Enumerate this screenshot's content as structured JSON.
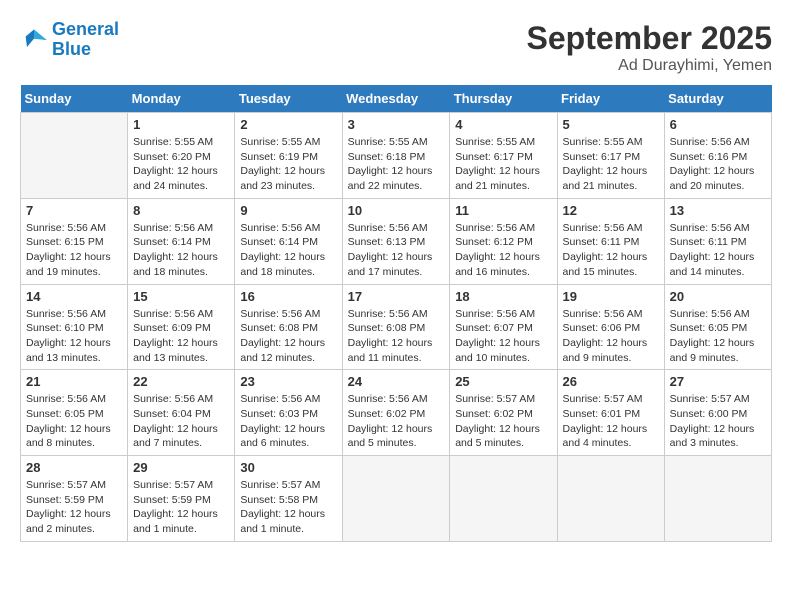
{
  "header": {
    "logo_line1": "General",
    "logo_line2": "Blue",
    "month": "September 2025",
    "location": "Ad Durayhimi, Yemen"
  },
  "weekdays": [
    "Sunday",
    "Monday",
    "Tuesday",
    "Wednesday",
    "Thursday",
    "Friday",
    "Saturday"
  ],
  "weeks": [
    [
      {
        "day": "",
        "sunrise": "",
        "sunset": "",
        "daylight": ""
      },
      {
        "day": "1",
        "sunrise": "Sunrise: 5:55 AM",
        "sunset": "Sunset: 6:20 PM",
        "daylight": "Daylight: 12 hours and 24 minutes."
      },
      {
        "day": "2",
        "sunrise": "Sunrise: 5:55 AM",
        "sunset": "Sunset: 6:19 PM",
        "daylight": "Daylight: 12 hours and 23 minutes."
      },
      {
        "day": "3",
        "sunrise": "Sunrise: 5:55 AM",
        "sunset": "Sunset: 6:18 PM",
        "daylight": "Daylight: 12 hours and 22 minutes."
      },
      {
        "day": "4",
        "sunrise": "Sunrise: 5:55 AM",
        "sunset": "Sunset: 6:17 PM",
        "daylight": "Daylight: 12 hours and 21 minutes."
      },
      {
        "day": "5",
        "sunrise": "Sunrise: 5:55 AM",
        "sunset": "Sunset: 6:17 PM",
        "daylight": "Daylight: 12 hours and 21 minutes."
      },
      {
        "day": "6",
        "sunrise": "Sunrise: 5:56 AM",
        "sunset": "Sunset: 6:16 PM",
        "daylight": "Daylight: 12 hours and 20 minutes."
      }
    ],
    [
      {
        "day": "7",
        "sunrise": "Sunrise: 5:56 AM",
        "sunset": "Sunset: 6:15 PM",
        "daylight": "Daylight: 12 hours and 19 minutes."
      },
      {
        "day": "8",
        "sunrise": "Sunrise: 5:56 AM",
        "sunset": "Sunset: 6:14 PM",
        "daylight": "Daylight: 12 hours and 18 minutes."
      },
      {
        "day": "9",
        "sunrise": "Sunrise: 5:56 AM",
        "sunset": "Sunset: 6:14 PM",
        "daylight": "Daylight: 12 hours and 18 minutes."
      },
      {
        "day": "10",
        "sunrise": "Sunrise: 5:56 AM",
        "sunset": "Sunset: 6:13 PM",
        "daylight": "Daylight: 12 hours and 17 minutes."
      },
      {
        "day": "11",
        "sunrise": "Sunrise: 5:56 AM",
        "sunset": "Sunset: 6:12 PM",
        "daylight": "Daylight: 12 hours and 16 minutes."
      },
      {
        "day": "12",
        "sunrise": "Sunrise: 5:56 AM",
        "sunset": "Sunset: 6:11 PM",
        "daylight": "Daylight: 12 hours and 15 minutes."
      },
      {
        "day": "13",
        "sunrise": "Sunrise: 5:56 AM",
        "sunset": "Sunset: 6:11 PM",
        "daylight": "Daylight: 12 hours and 14 minutes."
      }
    ],
    [
      {
        "day": "14",
        "sunrise": "Sunrise: 5:56 AM",
        "sunset": "Sunset: 6:10 PM",
        "daylight": "Daylight: 12 hours and 13 minutes."
      },
      {
        "day": "15",
        "sunrise": "Sunrise: 5:56 AM",
        "sunset": "Sunset: 6:09 PM",
        "daylight": "Daylight: 12 hours and 13 minutes."
      },
      {
        "day": "16",
        "sunrise": "Sunrise: 5:56 AM",
        "sunset": "Sunset: 6:08 PM",
        "daylight": "Daylight: 12 hours and 12 minutes."
      },
      {
        "day": "17",
        "sunrise": "Sunrise: 5:56 AM",
        "sunset": "Sunset: 6:08 PM",
        "daylight": "Daylight: 12 hours and 11 minutes."
      },
      {
        "day": "18",
        "sunrise": "Sunrise: 5:56 AM",
        "sunset": "Sunset: 6:07 PM",
        "daylight": "Daylight: 12 hours and 10 minutes."
      },
      {
        "day": "19",
        "sunrise": "Sunrise: 5:56 AM",
        "sunset": "Sunset: 6:06 PM",
        "daylight": "Daylight: 12 hours and 9 minutes."
      },
      {
        "day": "20",
        "sunrise": "Sunrise: 5:56 AM",
        "sunset": "Sunset: 6:05 PM",
        "daylight": "Daylight: 12 hours and 9 minutes."
      }
    ],
    [
      {
        "day": "21",
        "sunrise": "Sunrise: 5:56 AM",
        "sunset": "Sunset: 6:05 PM",
        "daylight": "Daylight: 12 hours and 8 minutes."
      },
      {
        "day": "22",
        "sunrise": "Sunrise: 5:56 AM",
        "sunset": "Sunset: 6:04 PM",
        "daylight": "Daylight: 12 hours and 7 minutes."
      },
      {
        "day": "23",
        "sunrise": "Sunrise: 5:56 AM",
        "sunset": "Sunset: 6:03 PM",
        "daylight": "Daylight: 12 hours and 6 minutes."
      },
      {
        "day": "24",
        "sunrise": "Sunrise: 5:56 AM",
        "sunset": "Sunset: 6:02 PM",
        "daylight": "Daylight: 12 hours and 5 minutes."
      },
      {
        "day": "25",
        "sunrise": "Sunrise: 5:57 AM",
        "sunset": "Sunset: 6:02 PM",
        "daylight": "Daylight: 12 hours and 5 minutes."
      },
      {
        "day": "26",
        "sunrise": "Sunrise: 5:57 AM",
        "sunset": "Sunset: 6:01 PM",
        "daylight": "Daylight: 12 hours and 4 minutes."
      },
      {
        "day": "27",
        "sunrise": "Sunrise: 5:57 AM",
        "sunset": "Sunset: 6:00 PM",
        "daylight": "Daylight: 12 hours and 3 minutes."
      }
    ],
    [
      {
        "day": "28",
        "sunrise": "Sunrise: 5:57 AM",
        "sunset": "Sunset: 5:59 PM",
        "daylight": "Daylight: 12 hours and 2 minutes."
      },
      {
        "day": "29",
        "sunrise": "Sunrise: 5:57 AM",
        "sunset": "Sunset: 5:59 PM",
        "daylight": "Daylight: 12 hours and 1 minute."
      },
      {
        "day": "30",
        "sunrise": "Sunrise: 5:57 AM",
        "sunset": "Sunset: 5:58 PM",
        "daylight": "Daylight: 12 hours and 1 minute."
      },
      {
        "day": "",
        "sunrise": "",
        "sunset": "",
        "daylight": ""
      },
      {
        "day": "",
        "sunrise": "",
        "sunset": "",
        "daylight": ""
      },
      {
        "day": "",
        "sunrise": "",
        "sunset": "",
        "daylight": ""
      },
      {
        "day": "",
        "sunrise": "",
        "sunset": "",
        "daylight": ""
      }
    ]
  ]
}
